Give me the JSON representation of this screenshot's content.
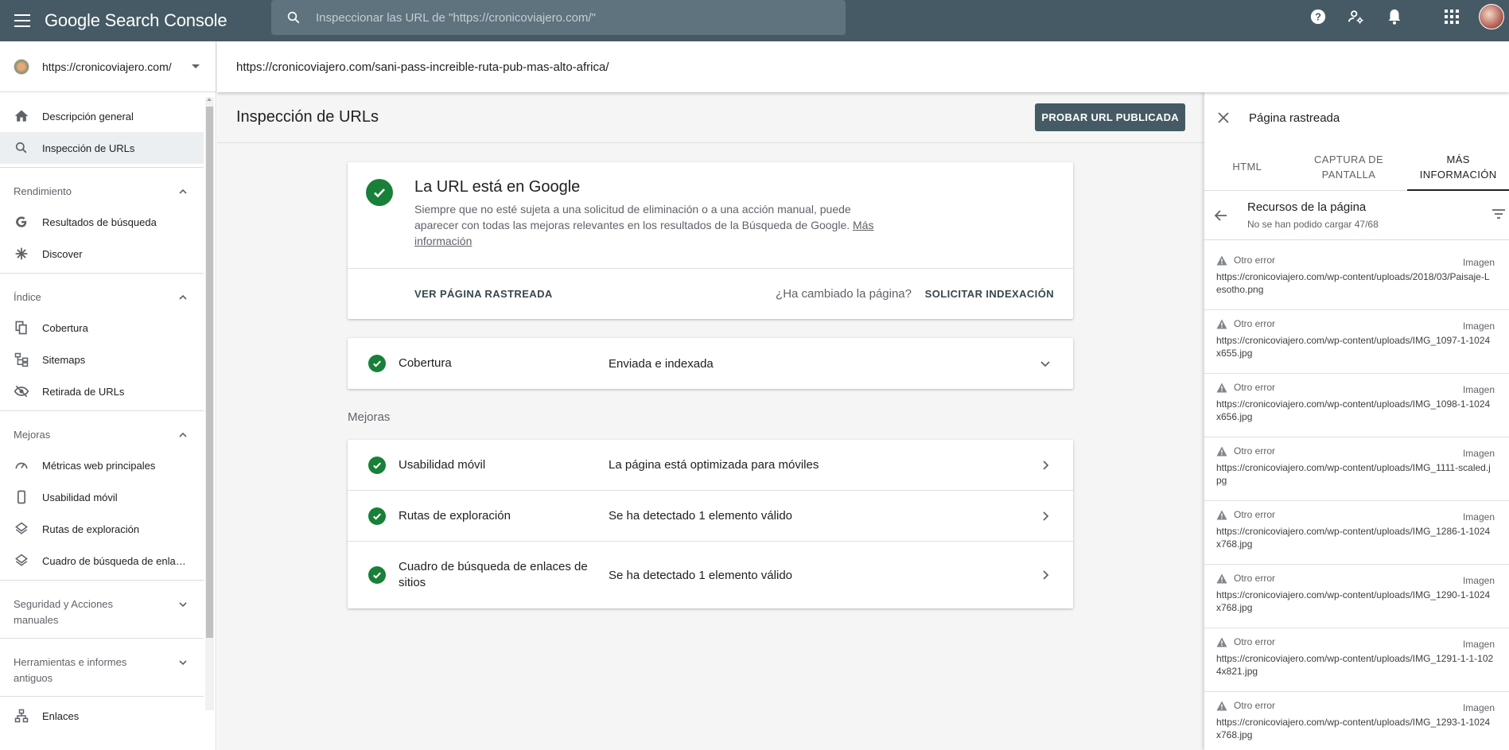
{
  "app": {
    "title": "Google Search Console",
    "search_placeholder": "Inspeccionar las URL de \"https://cronicoviajero.com/\""
  },
  "sidebar": {
    "property": "https://cronicoviajero.com/",
    "top_items": [
      {
        "label": "Descripción general",
        "icon": "home-icon"
      },
      {
        "label": "Inspección de URLs",
        "icon": "search-icon",
        "active": true
      }
    ],
    "sections": {
      "rendimiento": "Rendimiento",
      "indice": "Índice",
      "mejoras": "Mejoras",
      "seguridad": "Seguridad y Acciones manuales",
      "herramientas": "Herramientas e informes antiguos"
    },
    "rendimiento_items": [
      "Resultados de búsqueda",
      "Discover"
    ],
    "indice_items": [
      "Cobertura",
      "Sitemaps",
      "Retirada de URLs"
    ],
    "mejoras_items": [
      "Métricas web principales",
      "Usabilidad móvil",
      "Rutas de exploración",
      "Cuadro de búsqueda de enla…"
    ],
    "bottom_item": "Enlaces"
  },
  "urlbar": {
    "url": "https://cronicoviajero.com/sani-pass-increible-ruta-pub-mas-alto-africa/"
  },
  "main": {
    "title": "Inspección de URLs",
    "test_button": "PROBAR URL PUBLICADA",
    "status": {
      "title": "La URL está en Google",
      "description": "Siempre que no esté sujeta a una solicitud de eliminación o a una acción manual, puede aparecer con todas las mejoras relevantes en los resultados de la Búsqueda de Google.",
      "link": "Más información",
      "view_crawled": "VER PÁGINA RASTREADA",
      "changed_question": "¿Ha cambiado la página?",
      "request_indexing": "SOLICITAR INDEXACIÓN"
    },
    "coverage": {
      "label": "Cobertura",
      "value": "Enviada e indexada"
    },
    "enhancements_label": "Mejoras",
    "enhancements": [
      {
        "label": "Usabilidad móvil",
        "value": "La página está optimizada para móviles"
      },
      {
        "label": "Rutas de exploración",
        "value": "Se ha detectado 1 elemento válido"
      },
      {
        "label": "Cuadro de búsqueda de enlaces de sitios",
        "value": "Se ha detectado 1 elemento válido"
      }
    ]
  },
  "panel": {
    "title": "Página rastreada",
    "tabs": [
      "HTML",
      "CAPTURA DE PANTALLA",
      "MÁS INFORMACIÓN"
    ],
    "resources_title": "Recursos de la página",
    "resources_subtitle": "No se han podido cargar 47/68",
    "resources": [
      {
        "status": "Otro error",
        "type": "Imagen",
        "url": "https://cronicoviajero.com/wp-content/uploads/2018/03/Paisaje-Lesotho.png"
      },
      {
        "status": "Otro error",
        "type": "Imagen",
        "url": "https://cronicoviajero.com/wp-content/uploads/IMG_1097-1-1024x655.jpg"
      },
      {
        "status": "Otro error",
        "type": "Imagen",
        "url": "https://cronicoviajero.com/wp-content/uploads/IMG_1098-1-1024x656.jpg"
      },
      {
        "status": "Otro error",
        "type": "Imagen",
        "url": "https://cronicoviajero.com/wp-content/uploads/IMG_1111-scaled.jpg"
      },
      {
        "status": "Otro error",
        "type": "Imagen",
        "url": "https://cronicoviajero.com/wp-content/uploads/IMG_1286-1-1024x768.jpg"
      },
      {
        "status": "Otro error",
        "type": "Imagen",
        "url": "https://cronicoviajero.com/wp-content/uploads/IMG_1290-1-1024x768.jpg"
      },
      {
        "status": "Otro error",
        "type": "Imagen",
        "url": "https://cronicoviajero.com/wp-content/uploads/IMG_1291-1-1-1024x821.jpg"
      },
      {
        "status": "Otro error",
        "type": "Imagen",
        "url": "https://cronicoviajero.com/wp-content/uploads/IMG_1293-1-1024x768.jpg"
      }
    ]
  },
  "colors": {
    "topbar": "#455a64",
    "success": "#188038",
    "button": "#455a64"
  }
}
